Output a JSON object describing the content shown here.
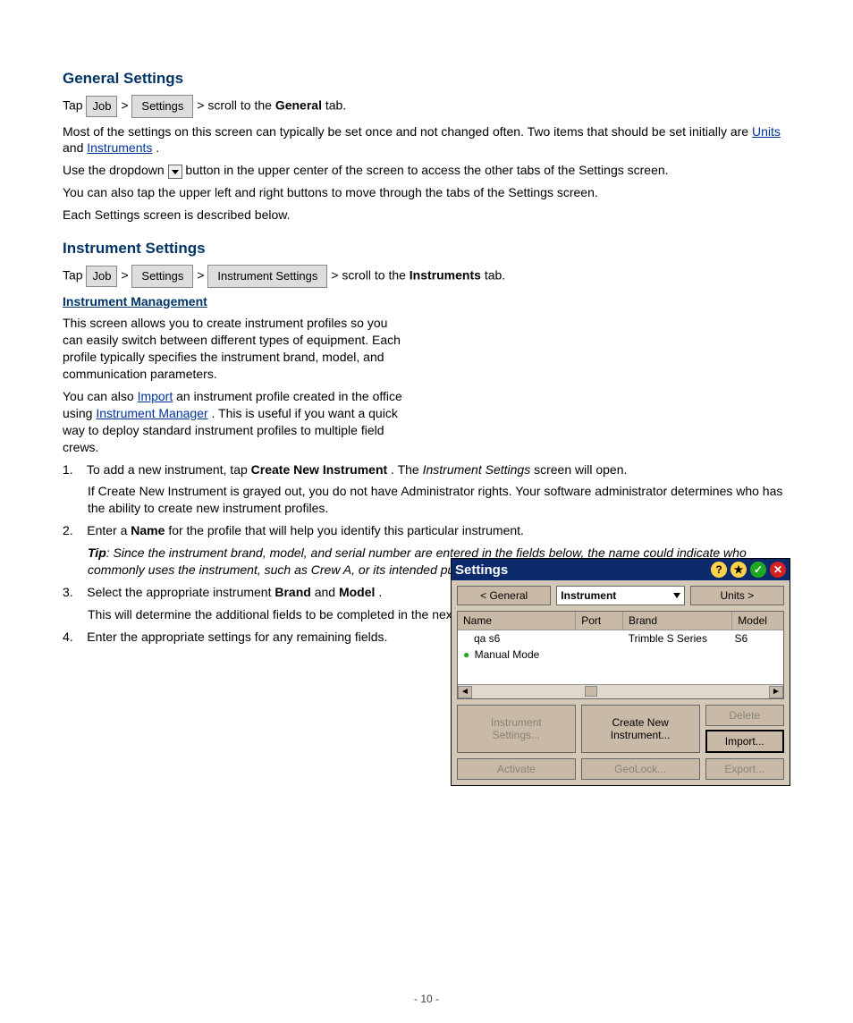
{
  "sections": {
    "general": {
      "title": "General Settings",
      "intro_line_parts": [
        "Tap ",
        " > ",
        " > scroll to the ",
        "General",
        " tab."
      ],
      "btn_job": "Job",
      "btn_settings": "Settings",
      "para2_parts": [
        "Most of the settings on this screen can typically be set once and not changed often. Two items that should be set initially are ",
        "Units",
        " and ",
        "Instruments",
        "."
      ],
      "para3_prefix": "Use the dropdown ",
      "para3_suffix": " button in the upper center of the screen to access the other tabs of the Settings screen.",
      "para4": "You can also tap the upper left and right buttons to move through the tabs of the Settings screen.",
      "para5": "Each Settings screen is described below."
    },
    "instrument": {
      "title": "Instrument Settings",
      "management_heading": "Instrument Management",
      "intro_parts": [
        "Tap ",
        " > ",
        " > ",
        " > scroll to the ",
        "Instruments",
        " tab."
      ],
      "btn_job": "Job",
      "btn_settings": "Settings",
      "btn_instrument": "Instrument Settings",
      "desc": "This screen allows you to create instrument profiles so you can easily switch between different types of equipment. Each profile typically specifies the instrument brand, model, and communication parameters.",
      "import_parts": [
        "You can also ",
        "Import",
        " an instrument profile created in the office using ",
        "Instrument Manager",
        ". This is useful if you want a quick way to deploy standard instrument profiles to multiple field crews."
      ],
      "step1_parts": [
        "1.",
        "To add a new instrument, tap ",
        "Create New Instrument",
        ". The ",
        "Instrument Settings",
        " screen will open."
      ],
      "step1_note": "If Create New Instrument is grayed out, you do not have Administrator rights. Your software administrator determines who has the ability to create new instrument profiles.",
      "step2_parts_a": [
        "2.",
        "Enter a ",
        "Name",
        " for the profile that will help you identify this particular instrument."
      ],
      "tip_label": "Tip",
      "tip_text": "Since the instrument brand, model, and serial number are entered in the fields below, the name could indicate who commonly uses the instrument, such as Crew A, or its intended purpose, such as GPS Rover.",
      "step3_parts": [
        "3.",
        "Select the appropriate instrument ",
        "Brand",
        " and ",
        "Model",
        "."
      ],
      "step3_note": "This will determine the additional fields to be completed in the next step.",
      "step4_parts": [
        "4.",
        "Enter the appropriate settings for any remaining fields."
      ]
    }
  },
  "settings_dialog": {
    "title": "Settings",
    "nav": {
      "left": "< General",
      "mid": "Instrument",
      "right": "Units >"
    },
    "columns": [
      "Name",
      "Port",
      "Brand",
      "Model"
    ],
    "rows": [
      {
        "dot": false,
        "name": "qa s6",
        "port": "",
        "brand": "Trimble S Series",
        "model": "S6"
      },
      {
        "dot": true,
        "name": "Manual Mode",
        "port": "",
        "brand": "",
        "model": ""
      }
    ],
    "buttons": {
      "instr_settings": "Instrument\nSettings...",
      "create_new": "Create New\nInstrument...",
      "delete": "Delete",
      "activate": "Activate",
      "geolock": "GeoLock...",
      "import": "Import...",
      "export": "Export..."
    }
  },
  "footer": "- 10 -"
}
